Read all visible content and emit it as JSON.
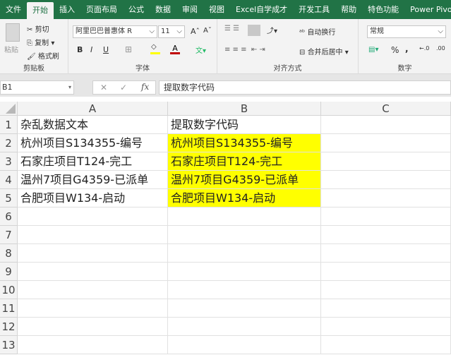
{
  "tabs": [
    "文件",
    "开始",
    "插入",
    "页面布局",
    "公式",
    "数据",
    "审阅",
    "视图",
    "Excel自学成才",
    "开发工具",
    "帮助",
    "特色功能",
    "Power Pivot"
  ],
  "ribbon": {
    "clipboard": {
      "paste": "粘贴",
      "cut": "剪切",
      "copy": "复制",
      "format_painter": "格式刷",
      "label": "剪贴板"
    },
    "font": {
      "name": "阿里巴巴普惠体 R",
      "size": "11",
      "bold": "B",
      "italic": "I",
      "underline": "U",
      "font_color": "A",
      "label": "字体",
      "colors": {
        "fill": "#ffff00",
        "font": "#c00000"
      }
    },
    "alignment": {
      "wrap": "自动换行",
      "merge": "合并后居中",
      "label": "对齐方式"
    },
    "number": {
      "format": "常规",
      "percent": "%",
      "comma": ",",
      "label": "数字"
    }
  },
  "formula_bar": {
    "name_box": "B1",
    "fx": "fx",
    "content": "提取数字代码"
  },
  "columns": [
    "A",
    "B",
    "C"
  ],
  "rows": [
    "1",
    "2",
    "3",
    "4",
    "5",
    "6",
    "7",
    "8",
    "9",
    "10",
    "11",
    "12",
    "13"
  ],
  "cells": {
    "A": [
      "杂乱数据文本",
      "杭州项目S134355-编号",
      "石家庄项目T124-完工",
      "温州7项目G4359-已派单",
      "合肥项目W134-启动"
    ],
    "B": [
      "提取数字代码",
      "杭州项目S134355-编号",
      "石家庄项目T124-完工",
      "温州7项目G4359-已派单",
      "合肥项目W134-启动"
    ]
  },
  "highlight_color": "#ffff00"
}
